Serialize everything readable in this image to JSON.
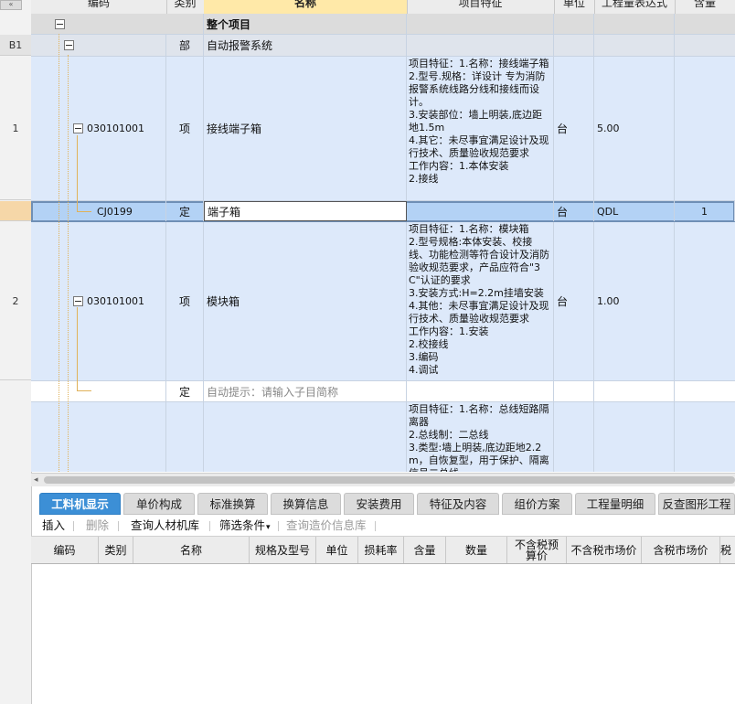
{
  "columns": {
    "code": "编码",
    "type": "类别",
    "name": "名称",
    "feature": "项目特征",
    "unit": "单位",
    "qty_expr": "工程量表达式",
    "content": "含量"
  },
  "rows": {
    "root": {
      "name": "整个项目"
    },
    "b1": {
      "header": "B1",
      "type": "部",
      "name": "自动报警系统"
    },
    "r1": {
      "header": "1",
      "code": "030101001",
      "type": "项",
      "name": "接线端子箱",
      "feature": "项目特征：1.名称：接线端子箱\n2.型号.规格：详设计 专为消防报警系统线路分线和接线而设计。\n3.安装部位：墙上明装,底边距地1.5m\n4.其它：未尽事宜满足设计及现行技术、质量验收规范要求\n工作内容：1.本体安装\n2.接线",
      "unit": "台",
      "qty_expr": "5.00"
    },
    "sub1": {
      "code": "CJ0199",
      "type": "定",
      "name": "端子箱",
      "unit": "台",
      "qty_expr": "QDL",
      "content": "1"
    },
    "r2": {
      "header": "2",
      "code": "030101001",
      "type": "项",
      "name": "模块箱",
      "feature": "项目特征：1.名称：模块箱\n2.型号规格:本体安装、校接线、功能检测等符合设计及消防验收规范要求，产品应符合\"3C\"认证的要求\n3.安装方式:H=2.2m挂墙安装\n4.其他：未尽事宜满足设计及现行技术、质量验收规范要求\n工作内容：1.安装\n2.校接线\n3.编码\n4.调试",
      "unit": "台",
      "qty_expr": "1.00"
    },
    "hint": {
      "type": "定",
      "name": "自动提示：请输入子目简称"
    },
    "r3": {
      "feature": "项目特征：1.名称：总线短路隔离器\n2.总线制：二总线\n3.类型:墙上明装,底边距地2.2m，自恢复型，用于保护、隔离信号二总线"
    }
  },
  "tabs": [
    "工料机显示",
    "单价构成",
    "标准换算",
    "换算信息",
    "安装费用",
    "特征及内容",
    "组价方案",
    "工程量明细",
    "反查图形工程"
  ],
  "toolbar": {
    "insert": "插入",
    "delete": "删除",
    "query_lib": "查询人材机库",
    "filter": "筛选条件",
    "filter_arrow": "▾",
    "query_price": "查询造价信息库"
  },
  "bottom_columns": [
    "编码",
    "类别",
    "名称",
    "规格及型号",
    "单位",
    "损耗率",
    "含量",
    "数量",
    "不含税预\n算价",
    "不含税市场价",
    "含税市场价",
    "税"
  ],
  "colors": {
    "selected_row": "#b3d2f5",
    "row_bg": "#dde9fa",
    "active_tab": "#3c8fd6"
  }
}
